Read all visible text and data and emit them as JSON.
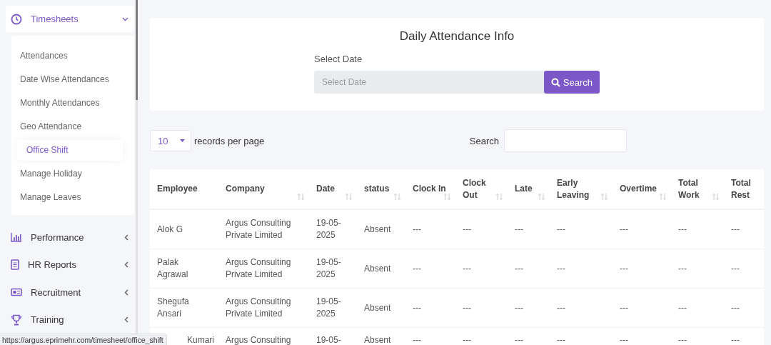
{
  "sidebar": {
    "group": {
      "label": "Timesheets",
      "expanded": true
    },
    "sub_items": [
      {
        "label": "Attendances",
        "selected": false
      },
      {
        "label": "Date Wise Attendances",
        "selected": false
      },
      {
        "label": "Monthly Attendances",
        "selected": false
      },
      {
        "label": "Geo Attendance",
        "selected": false
      },
      {
        "label": "Office Shift",
        "selected": true
      },
      {
        "label": "Manage Holiday",
        "selected": false
      },
      {
        "label": "Manage Leaves",
        "selected": false
      }
    ],
    "items": [
      {
        "label": "Performance",
        "expanded": false
      },
      {
        "label": "HR Reports",
        "expanded": false
      },
      {
        "label": "Recruitment",
        "expanded": false
      },
      {
        "label": "Training",
        "expanded": false
      }
    ]
  },
  "filter": {
    "title": "Daily Attendance Info",
    "field_label": "Select Date",
    "date_field": {
      "placeholder": "Select Date"
    },
    "search_button": "Search"
  },
  "table_controls": {
    "page_length": "10",
    "page_length_label": "records per page",
    "search_label": "Search"
  },
  "table": {
    "columns": [
      {
        "label": "Employee",
        "sortable": false
      },
      {
        "label": "Company",
        "sortable": true
      },
      {
        "label": "Date",
        "sortable": true
      },
      {
        "label": "status",
        "sortable": true
      },
      {
        "label": "Clock In",
        "sortable": true
      },
      {
        "label": "Clock Out",
        "sortable": true
      },
      {
        "label": "Late",
        "sortable": true
      },
      {
        "label": "Early Leaving",
        "sortable": true
      },
      {
        "label": "Overtime",
        "sortable": true
      },
      {
        "label": "Total Work",
        "sortable": true
      },
      {
        "label": "Total Rest",
        "sortable": false
      }
    ],
    "rows": [
      [
        "Alok G",
        "Argus Consulting Private Limited",
        "19-05-2025",
        "Absent",
        "---",
        "---",
        "---",
        "---",
        "---",
        "---",
        "---"
      ],
      [
        "Palak Agrawal",
        "Argus Consulting Private Limited",
        "19-05-2025",
        "Absent",
        "---",
        "---",
        "---",
        "---",
        "---",
        "---",
        "---"
      ],
      [
        "Shegufa Ansari",
        "Argus Consulting Private Limited",
        "19-05-2025",
        "Absent",
        "---",
        "---",
        "---",
        "---",
        "---",
        "---",
        "---"
      ],
      [
        "Kumari",
        "Argus Consulting",
        "19-05-",
        "Absent",
        "---",
        "---",
        "---",
        "---",
        "---",
        "---",
        "---"
      ]
    ]
  },
  "status_bar": {
    "url": "https://argus.eprimehr.com/timesheet/office_shift"
  }
}
